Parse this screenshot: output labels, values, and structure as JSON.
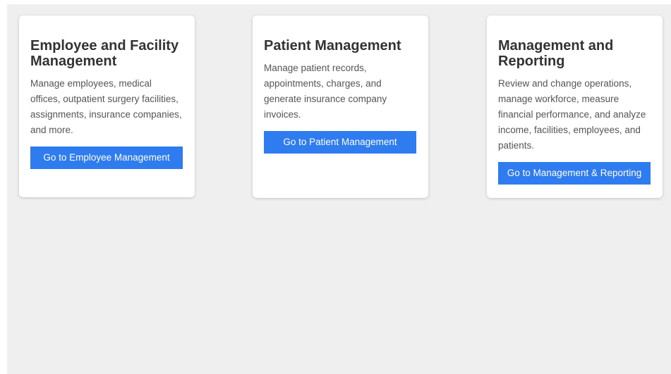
{
  "cards": [
    {
      "title": "Employee and Facility Management",
      "description": "Manage employees, medical offices, outpatient surgery facilities, assignments, insurance companies, and more.",
      "button_label": "Go to Employee Management"
    },
    {
      "title": "Patient Management",
      "description": "Manage patient records, appointments, charges, and generate insurance company invoices.",
      "button_label": "Go to Patient Management"
    },
    {
      "title": "Management and Reporting",
      "description": "Review and change operations, manage workforce, measure financial performance, and analyze income, facilities, employees, and patients.",
      "button_label": "Go to Management & Reporting"
    }
  ],
  "colors": {
    "background": "#efefef",
    "card": "#ffffff",
    "button": "#2f7bf0",
    "title_text": "#333333",
    "body_text": "#555555"
  }
}
